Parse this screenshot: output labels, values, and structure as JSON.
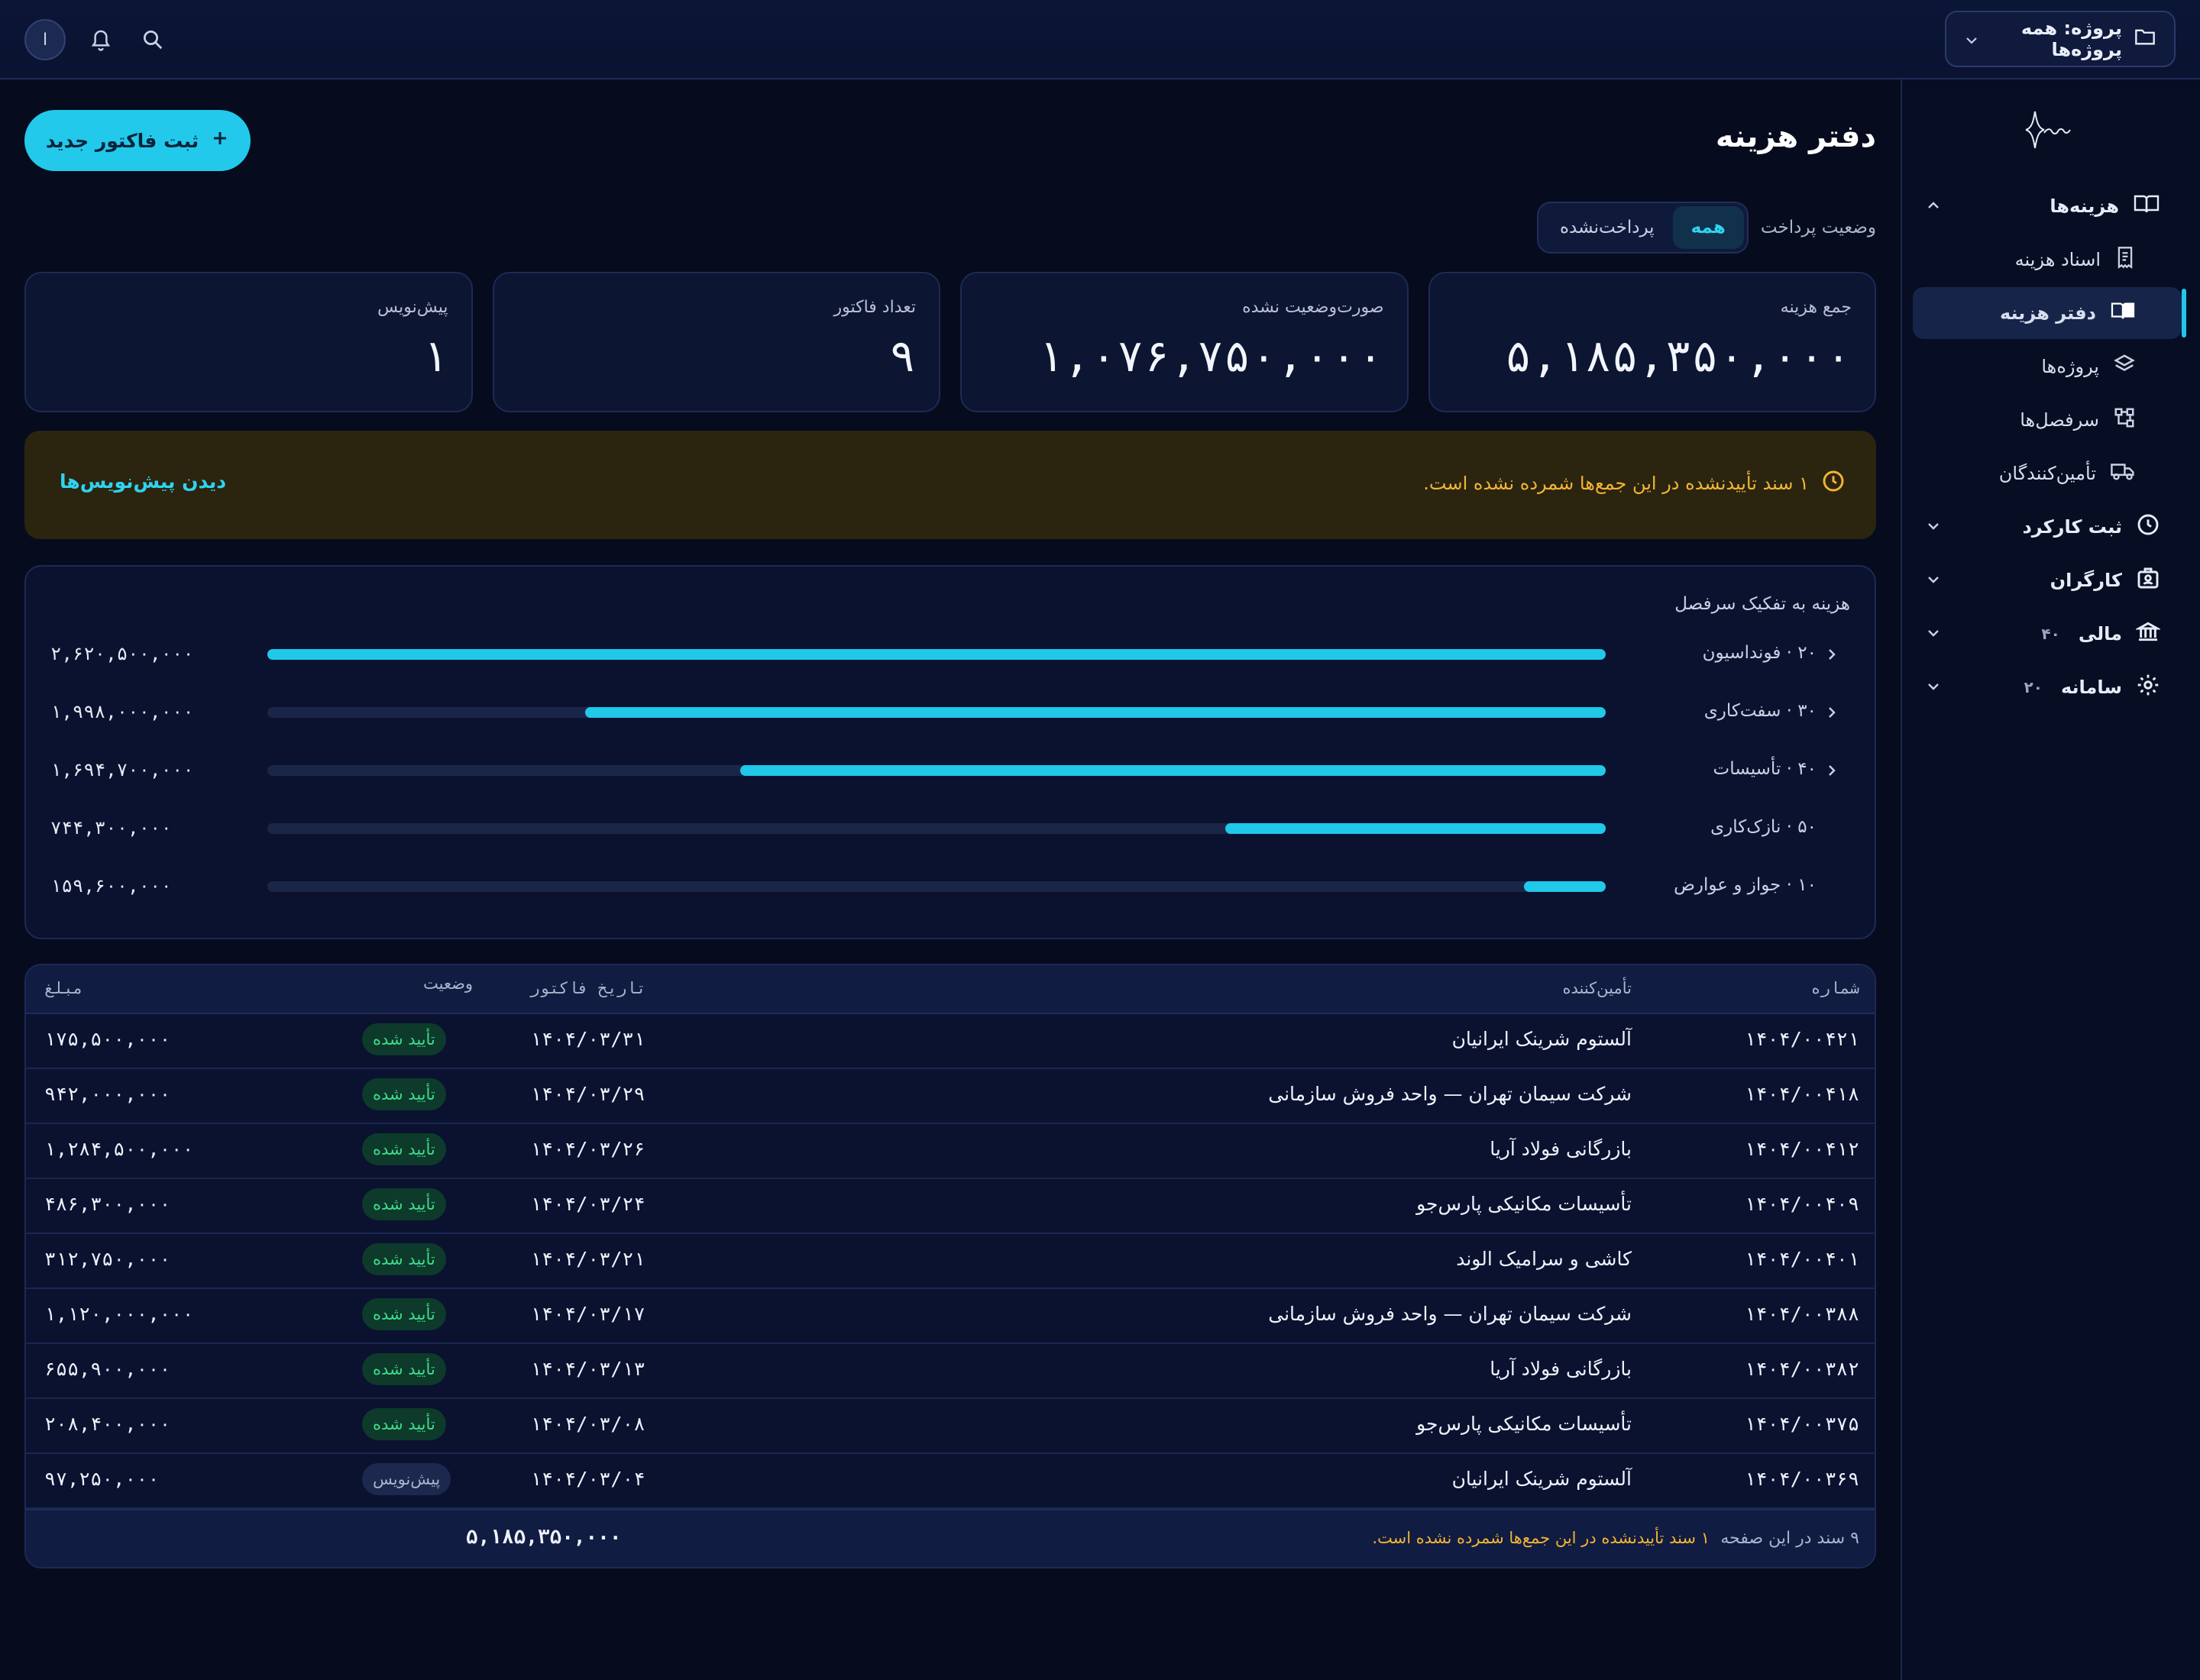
{
  "header": {
    "project_label": "پروژه: همه پروژه‌ها",
    "avatar_initial": "ا"
  },
  "sidebar": {
    "expenses_group": "هزینه‌ها",
    "expense_docs": "اسناد هزینه",
    "expense_ledger": "دفتر هزینه",
    "projects": "پروژه‌ها",
    "headings": "سرفصل‌ها",
    "suppliers": "تأمین‌کنندگان",
    "attendance": "ثبت کارکرد",
    "workers": "کارگران",
    "finance": "مالی",
    "finance_badge": "۴۰",
    "system": "سامانه",
    "system_badge": "۲۰"
  },
  "page": {
    "title": "دفتر هزینه",
    "new_invoice_button": "ثبت فاکتور جدید",
    "payment_status_label": "وضعیت پرداخت",
    "filter_all": "همه",
    "filter_unpaid": "پرداخت‌نشده"
  },
  "stats": [
    {
      "label": "جمع هزینه",
      "value": "۵,۱۸۵,۳۵۰,۰۰۰"
    },
    {
      "label": "صورت‌وضعیت نشده",
      "value": "۱,۰۷۶,۷۵۰,۰۰۰"
    },
    {
      "label": "تعداد فاکتور",
      "value": "۹"
    },
    {
      "label": "پیش‌نویس",
      "value": "۱"
    }
  ],
  "warning": {
    "message": "۱ سند تأییدنشده در این جمع‌ها شمرده نشده است.",
    "link": "دیدن پیش‌نویس‌ها"
  },
  "chart_data": {
    "type": "bar",
    "title": "هزینه به تفکیک سرفصل",
    "categories": [
      "۲۰ · فونداسیون",
      "۳۰ · سفت‌کاری",
      "۴۰ · تأسیسات",
      "۵۰ · نازک‌کاری",
      "۱۰ · جواز و عوارض"
    ],
    "values": [
      2620500000,
      1998000000,
      1694700000,
      744300000,
      159600000
    ],
    "value_labels": [
      "۲,۶۲۰,۵۰۰,۰۰۰",
      "۱,۹۹۸,۰۰۰,۰۰۰",
      "۱,۶۹۴,۷۰۰,۰۰۰",
      "۷۴۴,۳۰۰,۰۰۰",
      "۱۵۹,۶۰۰,۰۰۰"
    ],
    "expandable": [
      true,
      true,
      true,
      false,
      false
    ],
    "bar_color": "#20c8ea"
  },
  "table": {
    "columns": {
      "number": "شماره",
      "supplier": "تأمین‌کننده",
      "date": "تاریخ فاکتور",
      "status": "وضعیت",
      "amount": "مبلغ"
    },
    "rows": [
      {
        "number": "۱۴۰۴/۰۰۴۲۱",
        "supplier": "آلستوم شرینک ایرانیان",
        "date": "۱۴۰۴/۰۳/۳۱",
        "status": "تأیید شده",
        "status_kind": "ok",
        "amount": "۱۷۵,۵۰۰,۰۰۰"
      },
      {
        "number": "۱۴۰۴/۰۰۴۱۸",
        "supplier": "شرکت سیمان تهران — واحد فروش سازمانی",
        "date": "۱۴۰۴/۰۳/۲۹",
        "status": "تأیید شده",
        "status_kind": "ok",
        "amount": "۹۴۲,۰۰۰,۰۰۰"
      },
      {
        "number": "۱۴۰۴/۰۰۴۱۲",
        "supplier": "بازرگانی فولاد آریا",
        "date": "۱۴۰۴/۰۳/۲۶",
        "status": "تأیید شده",
        "status_kind": "ok",
        "amount": "۱,۲۸۴,۵۰۰,۰۰۰"
      },
      {
        "number": "۱۴۰۴/۰۰۴۰۹",
        "supplier": "تأسیسات مکانیکی پارس‌جو",
        "date": "۱۴۰۴/۰۳/۲۴",
        "status": "تأیید شده",
        "status_kind": "ok",
        "amount": "۴۸۶,۳۰۰,۰۰۰"
      },
      {
        "number": "۱۴۰۴/۰۰۴۰۱",
        "supplier": "کاشی و سرامیک الوند",
        "date": "۱۴۰۴/۰۳/۲۱",
        "status": "تأیید شده",
        "status_kind": "ok",
        "amount": "۳۱۲,۷۵۰,۰۰۰"
      },
      {
        "number": "۱۴۰۴/۰۰۳۸۸",
        "supplier": "شرکت سیمان تهران — واحد فروش سازمانی",
        "date": "۱۴۰۴/۰۳/۱۷",
        "status": "تأیید شده",
        "status_kind": "ok",
        "amount": "۱,۱۲۰,۰۰۰,۰۰۰"
      },
      {
        "number": "۱۴۰۴/۰۰۳۸۲",
        "supplier": "بازرگانی فولاد آریا",
        "date": "۱۴۰۴/۰۳/۱۳",
        "status": "تأیید شده",
        "status_kind": "ok",
        "amount": "۶۵۵,۹۰۰,۰۰۰"
      },
      {
        "number": "۱۴۰۴/۰۰۳۷۵",
        "supplier": "تأسیسات مکانیکی پارس‌جو",
        "date": "۱۴۰۴/۰۳/۰۸",
        "status": "تأیید شده",
        "status_kind": "ok",
        "amount": "۲۰۸,۴۰۰,۰۰۰"
      },
      {
        "number": "۱۴۰۴/۰۰۳۶۹",
        "supplier": "آلستوم شرینک ایرانیان",
        "date": "۱۴۰۴/۰۳/۰۴",
        "status": "پیش‌نویس",
        "status_kind": "draft",
        "amount": "۹۷,۲۵۰,۰۰۰"
      }
    ],
    "footer_count": "۹ سند در این صفحه",
    "footer_note": "۱ سند تأییدنشده در این جمع‌ها شمرده نشده است.",
    "footer_total": "۵,۱۸۵,۳۵۰,۰۰۰"
  },
  "colors": {
    "accent": "#22c9ea",
    "warning": "#f2b534",
    "success": "#3ddc8b",
    "background": "#060b1e"
  }
}
